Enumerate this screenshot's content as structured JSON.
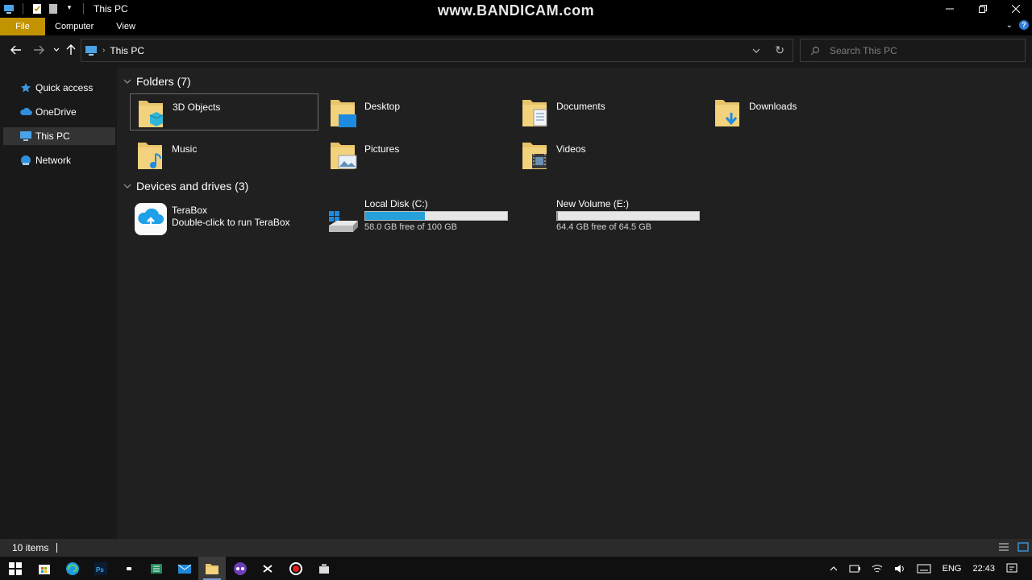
{
  "watermark": "www.BANDICAM.com",
  "window": {
    "title": "This PC"
  },
  "ribbon": {
    "tabs": [
      "File",
      "Computer",
      "View"
    ]
  },
  "address": {
    "path": "This PC"
  },
  "search": {
    "placeholder": "Search This PC"
  },
  "sidebar": {
    "items": [
      {
        "label": "Quick access",
        "icon": "star-icon"
      },
      {
        "label": "OneDrive",
        "icon": "cloud-icon"
      },
      {
        "label": "This PC",
        "icon": "computer-icon",
        "selected": true
      },
      {
        "label": "Network",
        "icon": "network-icon"
      }
    ]
  },
  "folders": {
    "header": "Folders (7)",
    "items": [
      {
        "label": "3D Objects",
        "icon": "3d-objects-folder-icon"
      },
      {
        "label": "Desktop",
        "icon": "desktop-folder-icon"
      },
      {
        "label": "Documents",
        "icon": "documents-folder-icon"
      },
      {
        "label": "Downloads",
        "icon": "downloads-folder-icon"
      },
      {
        "label": "Music",
        "icon": "music-folder-icon"
      },
      {
        "label": "Pictures",
        "icon": "pictures-folder-icon"
      },
      {
        "label": "Videos",
        "icon": "videos-folder-icon"
      }
    ]
  },
  "drives": {
    "header": "Devices and drives (3)",
    "terabox": {
      "name": "TeraBox",
      "subtitle": "Double-click to run TeraBox"
    },
    "items": [
      {
        "name": "Local Disk (C:)",
        "free": "58.0 GB free of 100 GB",
        "used_fraction": 0.42
      },
      {
        "name": "New Volume (E:)",
        "free": "64.4 GB free of 64.5 GB",
        "used_fraction": 0.002
      }
    ]
  },
  "status": {
    "count": "10 items"
  },
  "taskbar": {
    "tray": {
      "language": "ENG",
      "time": "22:43"
    }
  },
  "colors": {
    "file_tab": "#c29300",
    "accent": "#26a0da",
    "folder": "#e8c46a"
  }
}
